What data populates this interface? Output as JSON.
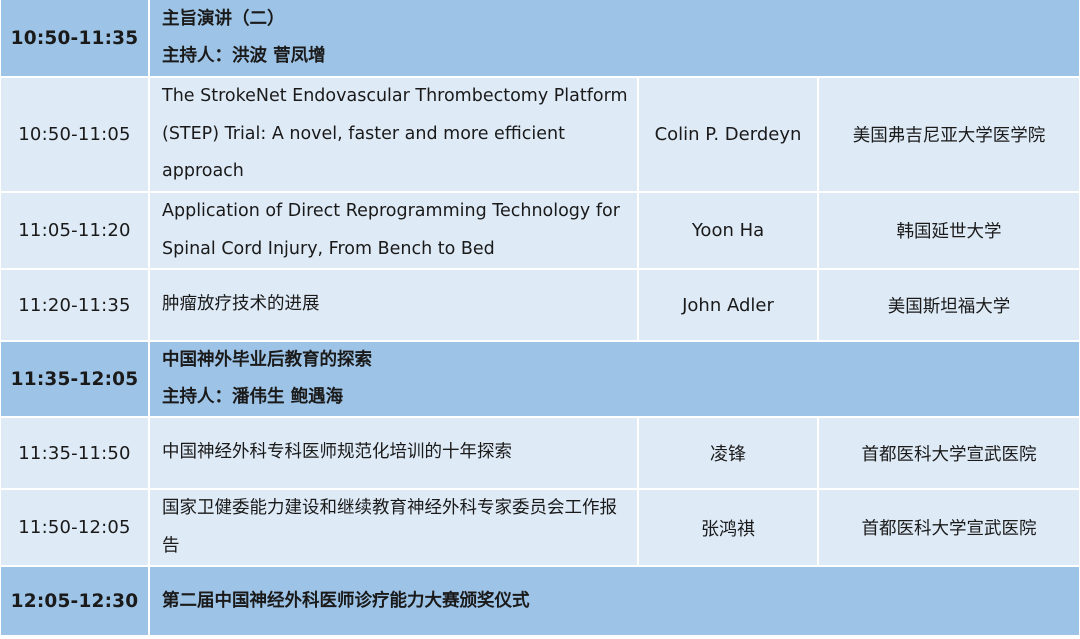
{
  "schedule": {
    "rows": [
      {
        "type": "session",
        "time": "10:50-11:35",
        "title": "主旨演讲（二）",
        "host": "主持人：洪波 菅凤增"
      },
      {
        "type": "talk",
        "time": "10:50-11:05",
        "title": "The StrokeNet Endovascular Thrombectomy Platform (STEP) Trial: A novel, faster and more efficient approach",
        "speaker": "Colin P. Derdeyn",
        "institution": "美国弗吉尼亚大学医学院"
      },
      {
        "type": "talk",
        "time": "11:05-11:20",
        "title": "Application of Direct Reprogramming Technology for Spinal Cord Injury, From Bench to Bed",
        "speaker": "Yoon Ha",
        "institution": "韩国延世大学"
      },
      {
        "type": "talk",
        "time": "11:20-11:35",
        "title": "肿瘤放疗技术的进展",
        "speaker": "John Adler",
        "institution": "美国斯坦福大学"
      },
      {
        "type": "session",
        "time": "11:35-12:05",
        "title": "中国神外毕业后教育的探索",
        "host": "主持人：潘伟生 鲍遇海"
      },
      {
        "type": "talk",
        "time": "11:35-11:50",
        "title": "中国神经外科专科医师规范化培训的十年探索",
        "speaker": "凌锋",
        "institution": "首都医科大学宣武医院"
      },
      {
        "type": "talk",
        "time": "11:50-12:05",
        "title": "国家卫健委能力建设和继续教育神经外科专家委员会工作报告",
        "speaker": "张鸿祺",
        "institution": "首都医科大学宣武医院"
      },
      {
        "type": "session",
        "time": "12:05-12:30",
        "title": "第二届中国神经外科医师诊疗能力大赛颁奖仪式"
      }
    ]
  },
  "colors": {
    "session_bg": "#9dc3e6",
    "talk_bg": "#deeaf6",
    "grid_line": "#ffffff",
    "text": "#1a1a1a"
  }
}
